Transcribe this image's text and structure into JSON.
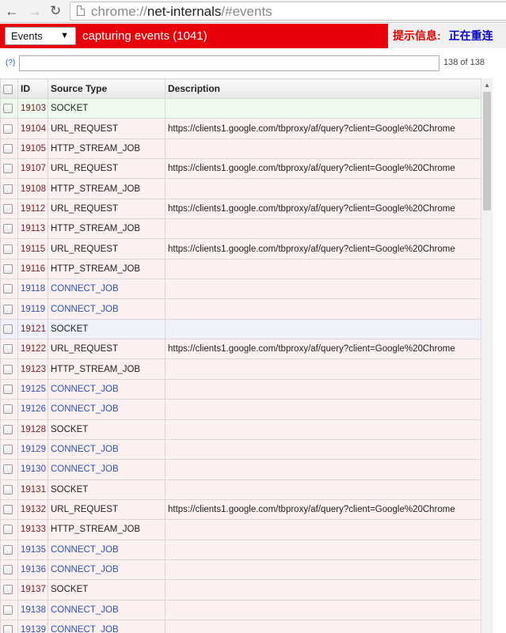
{
  "browser": {
    "url_scheme": "chrome://",
    "url_host": "net-internals",
    "url_path": "/#events"
  },
  "toolbar": {
    "view_select": "Events",
    "capturing_text": "capturing events (1041)",
    "notice_label": "提示信息:",
    "notice_value": "正在重连",
    "accent_color": "#e8000a"
  },
  "filter": {
    "help_link": "(?)",
    "value": "",
    "count": "138 of 138"
  },
  "table": {
    "headers": [
      "ID",
      "Source Type",
      "Description"
    ],
    "rows": [
      {
        "id": "19103",
        "type": "SOCKET",
        "desc": "",
        "kind": "socket-sel"
      },
      {
        "id": "19104",
        "type": "URL_REQUEST",
        "desc": "https://clients1.google.com/tbproxy/af/query?client=Google%20Chrome",
        "kind": "t-url"
      },
      {
        "id": "19105",
        "type": "HTTP_STREAM_JOB",
        "desc": "",
        "kind": "t-stream"
      },
      {
        "id": "19107",
        "type": "URL_REQUEST",
        "desc": "https://clients1.google.com/tbproxy/af/query?client=Google%20Chrome",
        "kind": "t-url"
      },
      {
        "id": "19108",
        "type": "HTTP_STREAM_JOB",
        "desc": "",
        "kind": "t-stream"
      },
      {
        "id": "19112",
        "type": "URL_REQUEST",
        "desc": "https://clients1.google.com/tbproxy/af/query?client=Google%20Chrome",
        "kind": "t-url"
      },
      {
        "id": "19113",
        "type": "HTTP_STREAM_JOB",
        "desc": "",
        "kind": "t-stream"
      },
      {
        "id": "19115",
        "type": "URL_REQUEST",
        "desc": "https://clients1.google.com/tbproxy/af/query?client=Google%20Chrome",
        "kind": "t-url"
      },
      {
        "id": "19116",
        "type": "HTTP_STREAM_JOB",
        "desc": "",
        "kind": "t-stream"
      },
      {
        "id": "19118",
        "type": "CONNECT_JOB",
        "desc": "",
        "kind": "t-conn"
      },
      {
        "id": "19119",
        "type": "CONNECT_JOB",
        "desc": "",
        "kind": "t-conn"
      },
      {
        "id": "19121",
        "type": "SOCKET",
        "desc": "",
        "kind": "t-socket2"
      },
      {
        "id": "19122",
        "type": "URL_REQUEST",
        "desc": "https://clients1.google.com/tbproxy/af/query?client=Google%20Chrome",
        "kind": "t-url"
      },
      {
        "id": "19123",
        "type": "HTTP_STREAM_JOB",
        "desc": "",
        "kind": "t-stream"
      },
      {
        "id": "19125",
        "type": "CONNECT_JOB",
        "desc": "",
        "kind": "t-conn"
      },
      {
        "id": "19126",
        "type": "CONNECT_JOB",
        "desc": "",
        "kind": "t-conn"
      },
      {
        "id": "19128",
        "type": "SOCKET",
        "desc": "",
        "kind": "t-socket"
      },
      {
        "id": "19129",
        "type": "CONNECT_JOB",
        "desc": "",
        "kind": "t-conn"
      },
      {
        "id": "19130",
        "type": "CONNECT_JOB",
        "desc": "",
        "kind": "t-conn"
      },
      {
        "id": "19131",
        "type": "SOCKET",
        "desc": "",
        "kind": "t-socket"
      },
      {
        "id": "19132",
        "type": "URL_REQUEST",
        "desc": "https://clients1.google.com/tbproxy/af/query?client=Google%20Chrome",
        "kind": "t-url"
      },
      {
        "id": "19133",
        "type": "HTTP_STREAM_JOB",
        "desc": "",
        "kind": "t-stream"
      },
      {
        "id": "19135",
        "type": "CONNECT_JOB",
        "desc": "",
        "kind": "t-conn"
      },
      {
        "id": "19136",
        "type": "CONNECT_JOB",
        "desc": "",
        "kind": "t-conn"
      },
      {
        "id": "19137",
        "type": "SOCKET",
        "desc": "",
        "kind": "t-socket"
      },
      {
        "id": "19138",
        "type": "CONNECT_JOB",
        "desc": "",
        "kind": "t-conn"
      },
      {
        "id": "19139",
        "type": "CONNECT_JOB",
        "desc": "",
        "kind": "t-conn"
      }
    ]
  }
}
